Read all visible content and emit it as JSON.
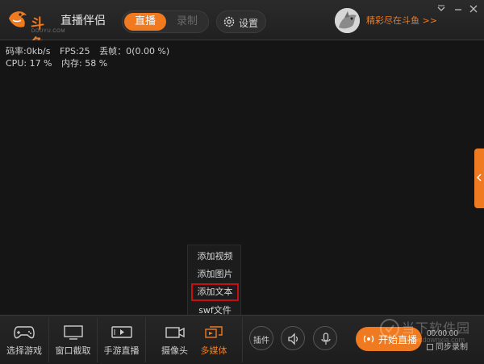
{
  "header": {
    "logo_text": "斗鱼",
    "logo_sub": "DOUYU.COM",
    "app_name": "直播伴侣",
    "mode_live": "直播",
    "mode_record": "录制",
    "settings_label": "设置",
    "promo_text": "精彩尽在斗鱼 >>"
  },
  "stats": {
    "bitrate": "码率:0kb/s",
    "fps": "FPS:25",
    "dropped": "丢帧：0(0.00 %)",
    "cpu": "CPU: 17 %",
    "memory": "内存: 58 %"
  },
  "popup_menu": {
    "items": [
      "添加视频",
      "添加图片",
      "添加文本",
      "swf文件"
    ],
    "selected_index": 2
  },
  "toolbar": {
    "tools": [
      "选择游戏",
      "窗口截取",
      "手游直播",
      "摄像头",
      "多媒体"
    ],
    "active_tool": "多媒体",
    "plugin_label": "插件",
    "start_label": "开始直播",
    "timer": "00:00:00",
    "sync_label": "同步录制"
  },
  "watermark": {
    "text": "当下软件园",
    "url": "www.downxia.com"
  },
  "colors": {
    "accent": "#f07a1f",
    "background": "#151515",
    "highlight_border": "#c41010"
  }
}
